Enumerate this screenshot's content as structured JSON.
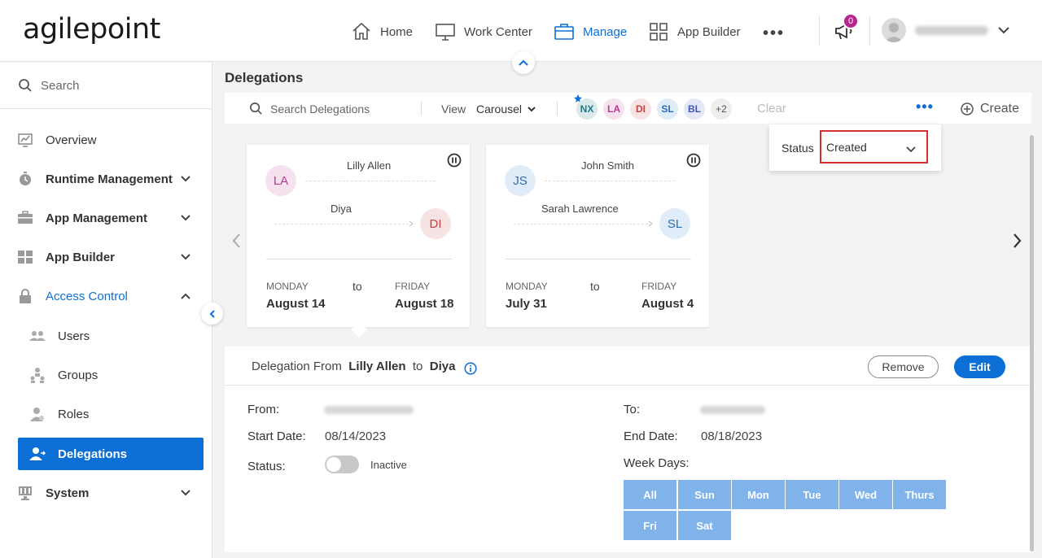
{
  "app": {
    "logo_text": "agilepoint"
  },
  "topnav": {
    "items": [
      {
        "label": "Home",
        "icon": "home-icon"
      },
      {
        "label": "Work Center",
        "icon": "monitor-icon"
      },
      {
        "label": "Manage",
        "icon": "briefcase-icon",
        "active": true
      },
      {
        "label": "App Builder",
        "icon": "grid-icon"
      }
    ],
    "notification_count": "0",
    "accent_color": "#0b6fd6",
    "badge_color": "#b5268e"
  },
  "sidebar": {
    "search_placeholder": "Search",
    "items": [
      {
        "label": "Overview",
        "icon": "chart-icon"
      },
      {
        "label": "Runtime Management",
        "icon": "timer-icon"
      },
      {
        "label": "App Management",
        "icon": "toolbox-icon"
      },
      {
        "label": "App Builder",
        "icon": "grid-icon"
      },
      {
        "label": "Access Control",
        "icon": "lock-icon"
      },
      {
        "label": "Users",
        "icon": "users-icon"
      },
      {
        "label": "Groups",
        "icon": "groups-icon"
      },
      {
        "label": "Roles",
        "icon": "role-icon"
      },
      {
        "label": "Delegations",
        "icon": "delegation-icon"
      },
      {
        "label": "System",
        "icon": "system-icon"
      }
    ]
  },
  "main": {
    "title": "Delegations",
    "toolbar": {
      "search_placeholder": "Search Delegations",
      "view_label": "View",
      "view_value": "Carousel",
      "chips": [
        {
          "initials": "NX",
          "bg": "#dbe9ea",
          "fg": "#1d7a86"
        },
        {
          "initials": "LA",
          "bg": "#f6e2ef",
          "fg": "#b53b8f"
        },
        {
          "initials": "DI",
          "bg": "#f6e3e3",
          "fg": "#c0413f"
        },
        {
          "initials": "SL",
          "bg": "#e0ecf8",
          "fg": "#2a6db7"
        },
        {
          "initials": "BL",
          "bg": "#e4e8f6",
          "fg": "#3b58b2"
        },
        {
          "initials": "+2",
          "bg": "#eeeeee",
          "fg": "#555555"
        }
      ],
      "clear_label": "Clear",
      "more_label": "•••",
      "create_label": "Create"
    },
    "status_filter": {
      "label": "Status",
      "value": "Created"
    },
    "cards": [
      {
        "from_initials": "LA",
        "from_name": "Lilly Allen",
        "to_initials": "DI",
        "to_name": "Diya",
        "start_day": "MONDAY",
        "start_date": "August 14",
        "to_word": "to",
        "end_day": "FRIDAY",
        "end_date": "August 18"
      },
      {
        "from_initials": "JS",
        "from_name": "John Smith",
        "to_initials": "SL",
        "to_name": "Sarah Lawrence",
        "start_day": "MONDAY",
        "start_date": "July 31",
        "to_word": "to",
        "end_day": "FRIDAY",
        "end_date": "August 4"
      }
    ],
    "detail": {
      "prefix": "Delegation From",
      "from_name": "Lilly Allen",
      "mid": "to",
      "to_name": "Diya",
      "remove_label": "Remove",
      "edit_label": "Edit",
      "from_label": "From:",
      "to_label": "To:",
      "start_label": "Start Date:",
      "start_value": "08/14/2023",
      "end_label": "End Date:",
      "end_value": "08/18/2023",
      "status_label": "Status:",
      "status_value": "Inactive",
      "weekdays_label": "Week Days:",
      "weekdays": [
        "All",
        "Sun",
        "Mon",
        "Tue",
        "Wed",
        "Thurs",
        "Fri",
        "Sat"
      ]
    }
  }
}
